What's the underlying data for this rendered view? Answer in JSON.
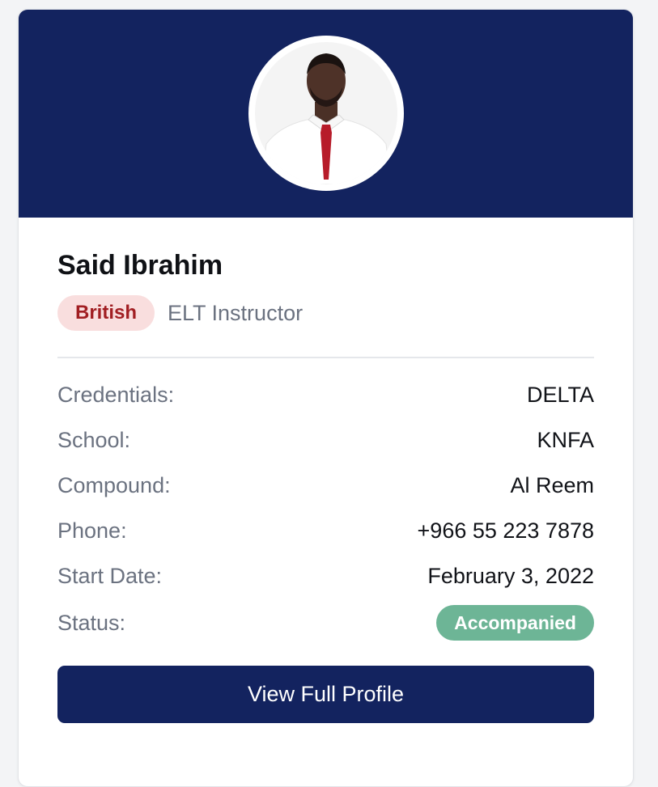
{
  "profile": {
    "name": "Said Ibrahim",
    "nationality": "British",
    "role": "ELT Instructor"
  },
  "details": [
    {
      "label": "Credentials:",
      "value": "DELTA"
    },
    {
      "label": "School:",
      "value": "KNFA"
    },
    {
      "label": "Compound:",
      "value": "Al Reem"
    },
    {
      "label": "Phone:",
      "value": "+966 55 223 7878"
    },
    {
      "label": "Start Date:",
      "value": "February 3, 2022"
    }
  ],
  "status": {
    "label": "Status:",
    "value": "Accompanied"
  },
  "actions": {
    "view_profile_label": "View Full Profile"
  },
  "colors": {
    "header": "#13235f",
    "nationality_badge_bg": "#f9dede",
    "nationality_badge_text": "#a11e22",
    "status_badge_bg": "#6db596",
    "button_bg": "#13235f"
  }
}
